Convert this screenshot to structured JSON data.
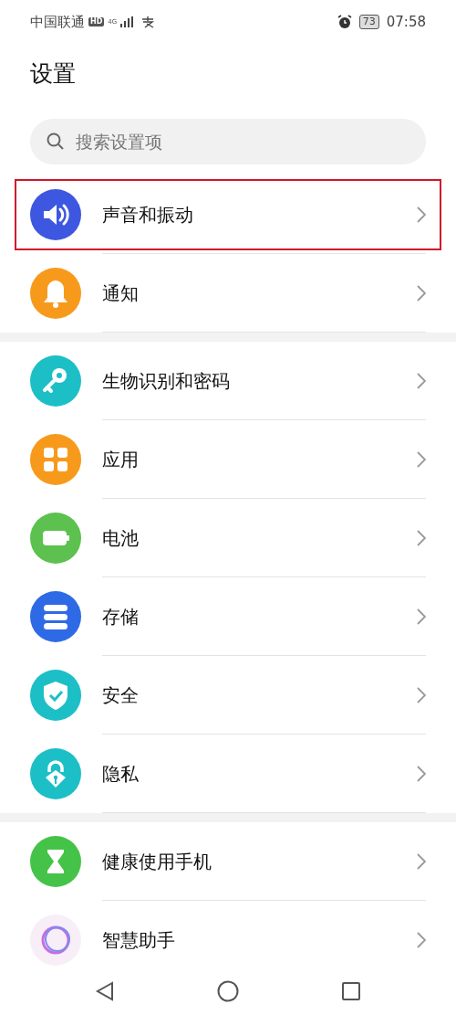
{
  "status_bar": {
    "carrier": "中国联通",
    "hd_badge": "HD",
    "network": "4G",
    "battery": "73",
    "time": "07:58"
  },
  "title": "设置",
  "search": {
    "placeholder": "搜索设置项"
  },
  "groups": [
    {
      "items": [
        {
          "label": "声音和振动",
          "kind": "sound",
          "color": "#3d57e0",
          "highlighted": true
        },
        {
          "label": "通知",
          "kind": "bell",
          "color": "#f79a1c",
          "highlighted": false
        }
      ]
    },
    {
      "items": [
        {
          "label": "生物识别和密码",
          "kind": "key",
          "color": "#1dbfc6",
          "highlighted": false
        },
        {
          "label": "应用",
          "kind": "apps",
          "color": "#f79a1c",
          "highlighted": false
        },
        {
          "label": "电池",
          "kind": "battery",
          "color": "#5cc14e",
          "highlighted": false
        },
        {
          "label": "存储",
          "kind": "storage",
          "color": "#2f6ae6",
          "highlighted": false
        },
        {
          "label": "安全",
          "kind": "shield",
          "color": "#1dbfc6",
          "highlighted": false
        },
        {
          "label": "隐私",
          "kind": "lock",
          "color": "#1dbfc6",
          "highlighted": false
        }
      ]
    },
    {
      "items": [
        {
          "label": "健康使用手机",
          "kind": "hourglass",
          "color": "#45c348",
          "highlighted": false
        },
        {
          "label": "智慧助手",
          "kind": "ring",
          "color": "#c86ee0",
          "highlighted": false
        }
      ]
    }
  ]
}
